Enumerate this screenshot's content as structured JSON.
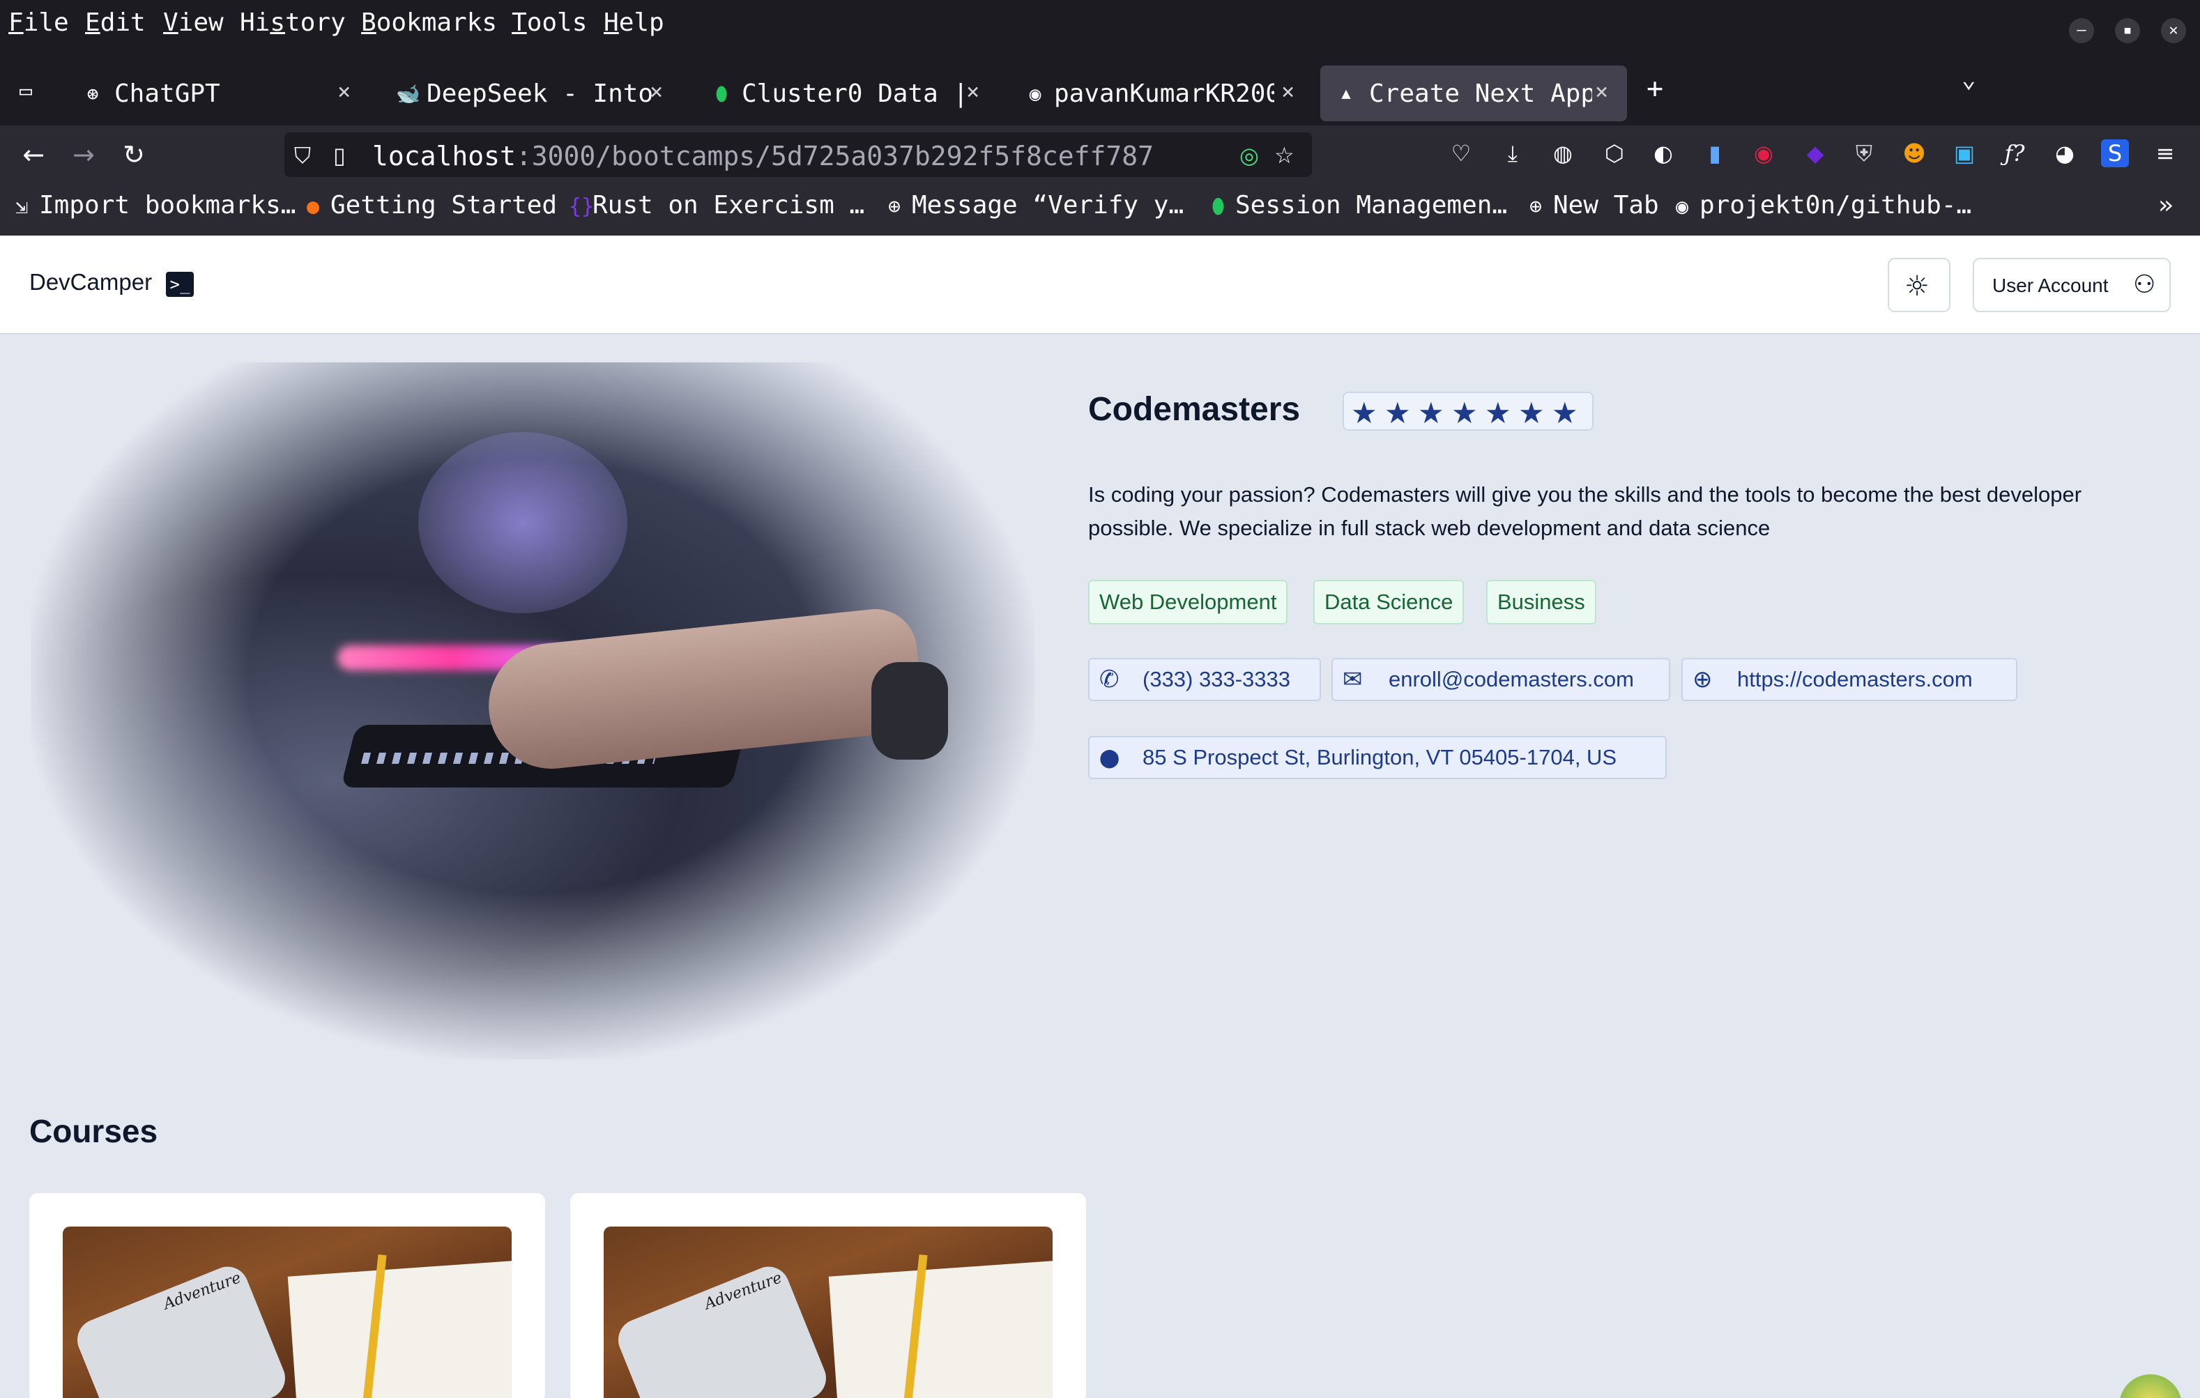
{
  "menubar": {
    "items": [
      {
        "accel": "F",
        "rest": "ile"
      },
      {
        "accel": "E",
        "rest": "dit"
      },
      {
        "accel": "V",
        "rest": "iew"
      },
      {
        "pre": "Hi",
        "accel": "s",
        "rest": "tory"
      },
      {
        "accel": "B",
        "rest": "ookmarks"
      },
      {
        "accel": "T",
        "rest": "ools"
      },
      {
        "accel": "H",
        "rest": "elp"
      }
    ]
  },
  "window_controls": {
    "minimize": "–",
    "maximize": "▪",
    "close": "✕"
  },
  "tabs": [
    {
      "label": "ChatGPT",
      "icon": "chatgpt-icon",
      "glyph": "⊛"
    },
    {
      "label": "DeepSeek - Into",
      "icon": "deepseek-whale-icon",
      "glyph": "🐋"
    },
    {
      "label": "Cluster0 Data |",
      "icon": "mongodb-leaf-icon",
      "glyph": "⬮"
    },
    {
      "label": "pavanKumarKR200",
      "icon": "github-icon",
      "glyph": "◉"
    },
    {
      "label": "Create Next App",
      "icon": "nextjs-icon",
      "glyph": "▲"
    }
  ],
  "tab_close_glyph": "×",
  "new_tab_glyph": "+",
  "tab_list_glyph": "⌄",
  "nav": {
    "back": "←",
    "forward": "→",
    "reload": "↻",
    "url_host": "localhost",
    "url_path": ":3000/bootcamps/5d725a037b292f5f8ceff787"
  },
  "bookmarks": [
    {
      "label": "Import bookmarks…",
      "icon": "import-icon",
      "glyph": "⇲"
    },
    {
      "label": "Getting Started",
      "icon": "firefox-icon",
      "glyph": "●"
    },
    {
      "label": "Rust on Exercism …",
      "icon": "exercism-icon",
      "glyph": "{}"
    },
    {
      "label": "Message “Verify y…",
      "icon": "globe-icon",
      "glyph": "⊕"
    },
    {
      "label": "Session Managemen…",
      "icon": "mongodb-leaf-icon",
      "glyph": "⬮"
    },
    {
      "label": "New Tab",
      "icon": "globe-icon",
      "glyph": "⊕"
    },
    {
      "label": "projekt0n/github-…",
      "icon": "github-icon",
      "glyph": "◉"
    }
  ],
  "bookmarks_overflow": "»",
  "app": {
    "brand": "DevCamper",
    "brand_logo": ">_",
    "theme_toggle_glyph": "☼",
    "account_label": "User Account",
    "account_glyph": "⚇"
  },
  "bootcamp": {
    "name": "Codemasters",
    "rating_stars": 7,
    "star_glyph": "★",
    "description": "Is coding your passion? Codemasters will give you the skills and the tools to become the best developer possible. We specialize in full stack web development and data science",
    "careers": [
      "Web Development",
      "Data Science",
      "Business"
    ],
    "phone": "(333) 333-3333",
    "email": "enroll@codemasters.com",
    "website": "https://codemasters.com",
    "address": "85 S Prospect St, Burlington, VT 05405-1704, US",
    "icons": {
      "phone": "✆",
      "email": "✉",
      "website": "⊕",
      "address": "⬤"
    }
  },
  "courses": {
    "heading": "Courses",
    "sticker_text": "Adventure"
  }
}
